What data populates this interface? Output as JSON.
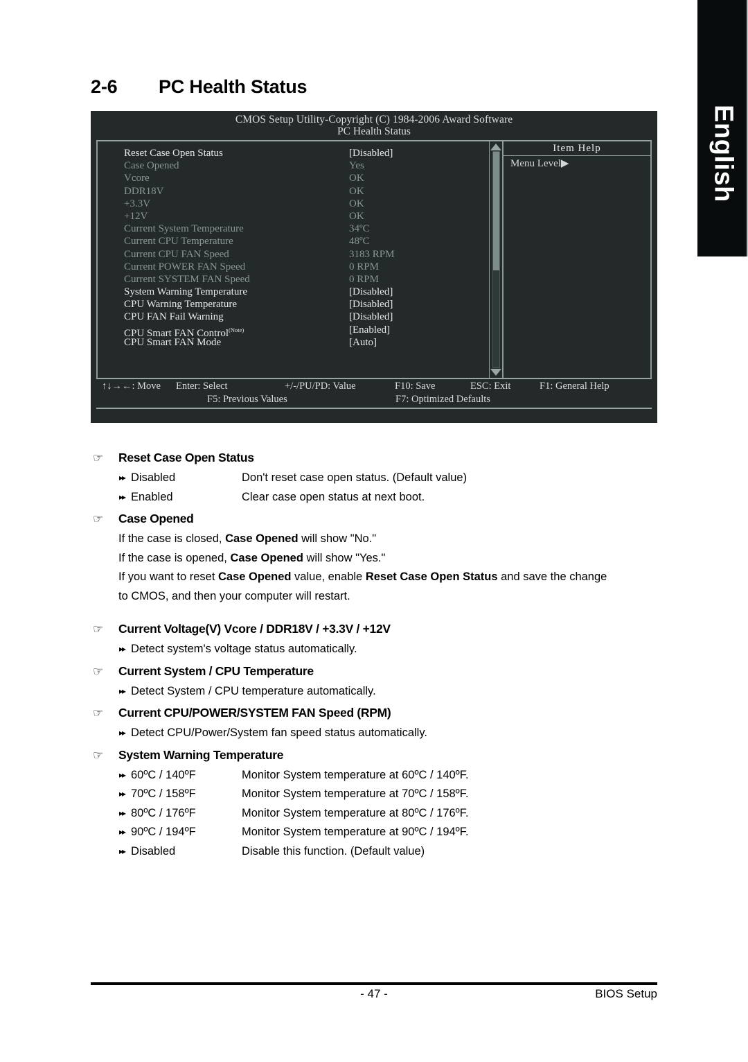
{
  "language_tab": {
    "label": "English"
  },
  "heading": {
    "number": "2-6",
    "title": "PC Health Status"
  },
  "bios": {
    "title": "CMOS Setup Utility-Copyright (C) 1984-2006 Award Software",
    "subtitle": "PC Health Status",
    "rows": [
      {
        "label": "Reset Case Open Status",
        "value": "[Disabled]",
        "state": "bright"
      },
      {
        "label": "Case Opened",
        "value": "Yes",
        "state": "dim"
      },
      {
        "label": "Vcore",
        "value": "OK",
        "state": "dim"
      },
      {
        "label": "DDR18V",
        "value": "OK",
        "state": "dim"
      },
      {
        "label": "+3.3V",
        "value": "OK",
        "state": "dim"
      },
      {
        "label": "+12V",
        "value": "OK",
        "state": "dim"
      },
      {
        "label": "Current System Temperature",
        "value": "34ºC",
        "state": "dim"
      },
      {
        "label": "Current CPU Temperature",
        "value": "48ºC",
        "state": "dim"
      },
      {
        "label": "Current CPU FAN Speed",
        "value": "3183 RPM",
        "state": "dim"
      },
      {
        "label": "Current POWER FAN Speed",
        "value": "0     RPM",
        "state": "dim"
      },
      {
        "label": "Current SYSTEM FAN Speed",
        "value": "0     RPM",
        "state": "dim"
      },
      {
        "label": "System Warning Temperature",
        "value": "[Disabled]",
        "state": "bright"
      },
      {
        "label": "CPU Warning Temperature",
        "value": "[Disabled]",
        "state": "bright"
      },
      {
        "label": "CPU FAN Fail Warning",
        "value": "[Disabled]",
        "state": "bright"
      },
      {
        "label": "CPU Smart FAN Control",
        "note": "(Note)",
        "value": "[Enabled]",
        "state": "bright"
      },
      {
        "label": "CPU Smart FAN Mode",
        "value": "[Auto]",
        "state": "bright"
      }
    ],
    "help": {
      "title": "Item Help",
      "menu_level": "Menu Level▶"
    },
    "footer": {
      "move": "↑↓→←: Move",
      "enter": "Enter: Select",
      "value": "+/-/PU/PD: Value",
      "f10": "F10: Save",
      "esc": "ESC: Exit",
      "f1": "F1: General Help",
      "f5": "F5: Previous Values",
      "f7": "F7: Optimized Defaults"
    }
  },
  "sections": {
    "reset_case_open_status": {
      "title": "Reset Case Open Status",
      "options": [
        {
          "name": "Disabled",
          "desc": "Don't reset case open status. (Default value)"
        },
        {
          "name": "Enabled",
          "desc": "Clear case open status at next boot."
        }
      ]
    },
    "case_opened": {
      "title": "Case Opened",
      "p1_a": "If the case is closed, ",
      "p1_b": "Case Opened",
      "p1_c": " will show \"No.\"",
      "p2_a": "If the case is opened, ",
      "p2_b": "Case Opened",
      "p2_c": " will show \"Yes.\"",
      "p3_a": "If you want to reset ",
      "p3_b": "Case Opened",
      "p3_c": " value, enable ",
      "p3_d": "Reset Case Open Status",
      "p3_e": " and save the change",
      "p4": "to CMOS, and then your computer will restart."
    },
    "current_voltage": {
      "title": "Current Voltage(V) Vcore / DDR18V / +3.3V / +12V",
      "option": "Detect system's voltage status automatically."
    },
    "current_temperature": {
      "title": "Current System / CPU Temperature",
      "option": "Detect System / CPU temperature automatically."
    },
    "current_fan_speed": {
      "title": "Current CPU/POWER/SYSTEM FAN Speed (RPM)",
      "option": "Detect CPU/Power/System fan speed status automatically."
    },
    "system_warning_temperature": {
      "title": "System Warning Temperature",
      "options": [
        {
          "name": "60ºC / 140ºF",
          "desc": "Monitor System temperature at 60ºC / 140ºF."
        },
        {
          "name": "70ºC / 158ºF",
          "desc": "Monitor System temperature at 70ºC / 158ºF."
        },
        {
          "name": "80ºC / 176ºF",
          "desc": "Monitor System temperature at 80ºC / 176ºF."
        },
        {
          "name": "90ºC / 194ºF",
          "desc": "Monitor System temperature at 90ºC / 194ºF."
        },
        {
          "name": "Disabled",
          "desc": "Disable this function. (Default value)"
        }
      ]
    }
  },
  "footer": {
    "page_number": "- 47 -",
    "section_label": "BIOS Setup"
  },
  "icons": {
    "hand": "☞",
    "double_arrow": "▸▸"
  }
}
